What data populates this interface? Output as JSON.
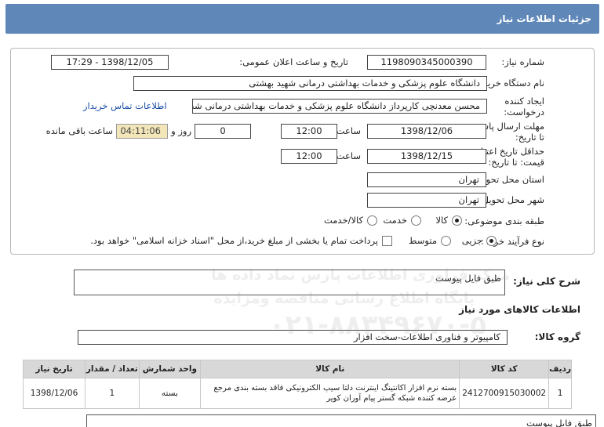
{
  "header": {
    "title": "جزئیات اطلاعات نیاز"
  },
  "form": {
    "need_number": {
      "label": "شماره نیاز:",
      "value": "1198090345000390"
    },
    "announce_datetime": {
      "label": "تاریخ و ساعت اعلان عمومی:",
      "value": "1398/12/05 - 17:29"
    },
    "buyer_org": {
      "label": "نام دستگاه خریدار:",
      "value": "دانشگاه علوم پزشکی و خدمات بهداشتی درمانی شهید بهشتی"
    },
    "requester": {
      "label_line1": "ایجاد کننده",
      "label_line2": "درخواست:",
      "value": "محسن معدنچی کارپرداز دانشگاه علوم پزشکی و خدمات بهداشتی درمانی شه",
      "contact_link": "اطلاعات تماس خریدار"
    },
    "reply_deadline": {
      "label_line1": "مهلت ارسال پاسخ:",
      "label_line2": "تا تاریخ:",
      "date": "1398/12/06",
      "time_label": "ساعت",
      "time": "12:00",
      "days": "0",
      "days_label": "روز و",
      "remaining": "04:11:06",
      "remaining_label": "ساعت باقی مانده"
    },
    "price_validity": {
      "label_line1": "حداقل تاریخ اعتبار",
      "label_line2": "قیمت: تا تاریخ:",
      "date": "1398/12/15",
      "time_label": "ساعت",
      "time": "12:00"
    },
    "delivery_province": {
      "label": "استان محل تحویل:",
      "value": "تهران"
    },
    "delivery_city": {
      "label": "شهر محل تحویل:",
      "value": "تهران"
    },
    "category": {
      "label": "طبقه بندی موضوعی:",
      "options": [
        "کالا",
        "خدمت",
        "کالا/خدمت"
      ],
      "selected": "کالا"
    },
    "purchase_process": {
      "label": "نوع فرآیند خرید :",
      "options": [
        "جزیی",
        "متوسط"
      ],
      "selected": "جزیی",
      "checkbox_note": "پرداخت تمام یا بخشی از مبلغ خرید،از محل \"اسناد خزانه اسلامی\" خواهد بود."
    }
  },
  "summary": {
    "label": "شرح کلی نیاز:",
    "value": "طبق فایل پیوست"
  },
  "goods_info": {
    "heading": "اطلاعات کالاهای مورد نیاز"
  },
  "goods_group": {
    "label": "گروه کالا:",
    "value": "کامپیوتر و فناوری اطلاعات-سخت افزار"
  },
  "table": {
    "columns": [
      "ردیف",
      "کد کالا",
      "نام کالا",
      "واحد شمارش",
      "تعداد / مقدار",
      "تاریخ نیاز"
    ],
    "rows": [
      {
        "index": "1",
        "code": "2412700915030002",
        "name": "بسته نرم افزار اکانتینگ اینترنت دلتا سیپ الکترونیکی فاقد بسته بندی مرجع عرضه کننده شبکه گستر پیام آوران کویر",
        "unit": "بسته",
        "qty": "1",
        "date": "1398/12/06"
      }
    ]
  },
  "footer_note": {
    "value": "طبق فایل پیوست"
  },
  "watermark": {
    "line1": "مرکز فراوری اطلاعات پارس نماد داده ها",
    "line2": "پایگاه اطلاع رسانی مناقصه ومزایده",
    "line3": "۰۲۱-۸۸۳۴۹۶۷۰-۵"
  }
}
